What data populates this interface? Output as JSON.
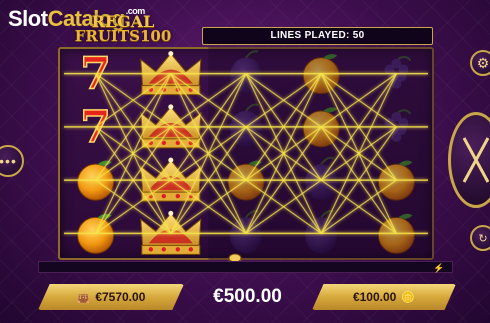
{
  "watermark": {
    "part1": "Slot",
    "part2": "Catalog",
    "part3": ".com"
  },
  "game": {
    "logo_line1": "REGAL",
    "logo_line2": "FRUITS100"
  },
  "status": {
    "lines_played": "LINES PLAYED: 50"
  },
  "symbols": {
    "seven": "7",
    "crown": "crown",
    "orange": "orange",
    "grapes": "grapes",
    "plum": "plum"
  },
  "grid": {
    "columns": 5,
    "rows": 4,
    "cells": [
      [
        "seven",
        "crown",
        "plum",
        "orange",
        "grapes"
      ],
      [
        "seven",
        "crown",
        "plum",
        "orange",
        "grapes"
      ],
      [
        "orange",
        "crown",
        "orange",
        "plum",
        "orange"
      ],
      [
        "orange",
        "crown",
        "plum",
        "plum",
        "orange"
      ]
    ]
  },
  "footer": {
    "balance": "€7570.00",
    "win": "€500.00",
    "bet": "€100.00"
  },
  "icons": {
    "menu": "menu-dots-icon",
    "settings": "gear-icon",
    "spin": "spin-arrows-icon",
    "autoplay": "autoplay-icon",
    "wallet": "wallet-icon",
    "coins": "coins-stack-icon",
    "bolt": "lightning-icon"
  },
  "colors": {
    "gold": "#e8c23a",
    "purple": "#3d0e4d",
    "payline": "#f7e44a"
  }
}
